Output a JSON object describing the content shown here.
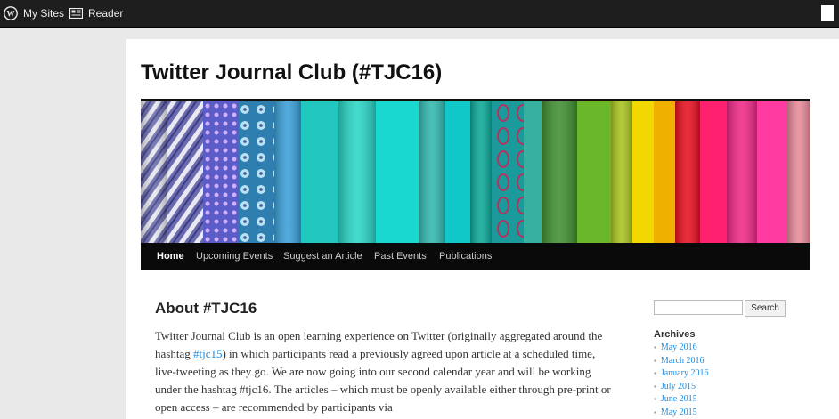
{
  "admin_bar": {
    "my_sites_label": "My Sites",
    "reader_label": "Reader"
  },
  "site": {
    "title": "Twitter Journal Club (#TJC16)"
  },
  "nav": {
    "items": [
      {
        "label": "Home",
        "current": true
      },
      {
        "label": "Upcoming Events"
      },
      {
        "label": "Suggest an Article"
      },
      {
        "label": "Past Events"
      },
      {
        "label": "Publications"
      }
    ]
  },
  "entry": {
    "title": "About #TJC16",
    "paragraph_part1": "Twitter Journal Club is an open learning experience on Twitter (originally aggregated around the hashtag ",
    "hashtag_link": "#tjc15",
    "paragraph_part2": ") in which participants read a previously agreed upon article at a scheduled time, live-tweeting as they go.  We are now going into our second calendar year and will be working under the hashtag #tjc16.  The articles – which must be openly available either through pre-print or open access – are recommended by participants via"
  },
  "sidebar": {
    "search_placeholder": "",
    "search_button_label": "Search",
    "archives_title": "Archives",
    "archives": [
      "May 2016",
      "March 2016",
      "January 2016",
      "July 2015",
      "June 2015",
      "May 2015"
    ]
  },
  "colors": {
    "admin_bar_bg": "#1e1e1e",
    "nav_bg": "#0a0a0a",
    "link": "#1b8be0"
  }
}
